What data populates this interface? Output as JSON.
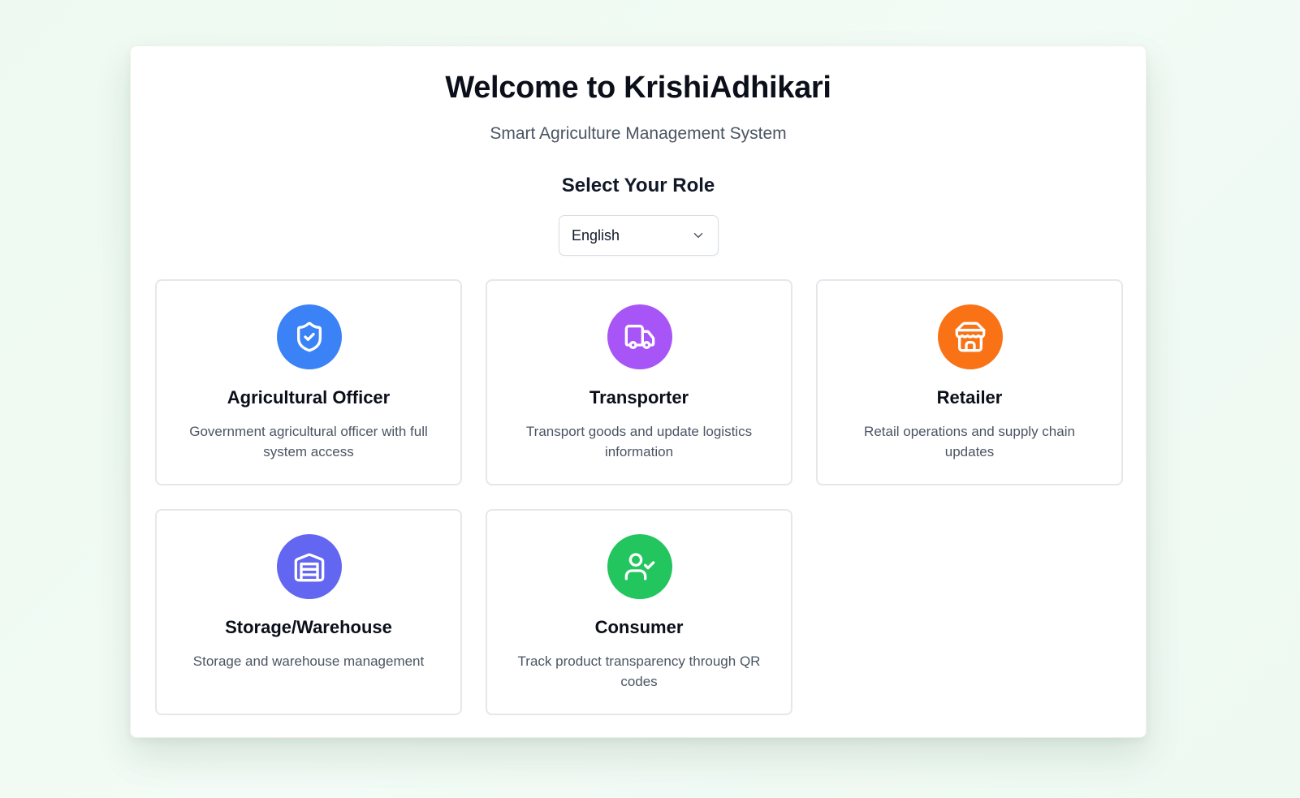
{
  "header": {
    "title": "Welcome to KrishiAdhikari",
    "subtitle": "Smart Agriculture Management System",
    "role_heading": "Select Your Role"
  },
  "language": {
    "selected": "English"
  },
  "roles": [
    {
      "title": "Agricultural Officer",
      "description": "Government agricultural officer with full system access",
      "icon": "shield-check-icon",
      "color": "#3b82f6"
    },
    {
      "title": "Transporter",
      "description": "Transport goods and update logistics information",
      "icon": "truck-icon",
      "color": "#a855f7"
    },
    {
      "title": "Retailer",
      "description": "Retail operations and supply chain updates",
      "icon": "store-icon",
      "color": "#f97316"
    },
    {
      "title": "Storage/Warehouse",
      "description": "Storage and warehouse management",
      "icon": "warehouse-icon",
      "color": "#6366f1"
    },
    {
      "title": "Consumer",
      "description": "Track product transparency through QR codes",
      "icon": "user-check-icon",
      "color": "#22c55e"
    }
  ]
}
